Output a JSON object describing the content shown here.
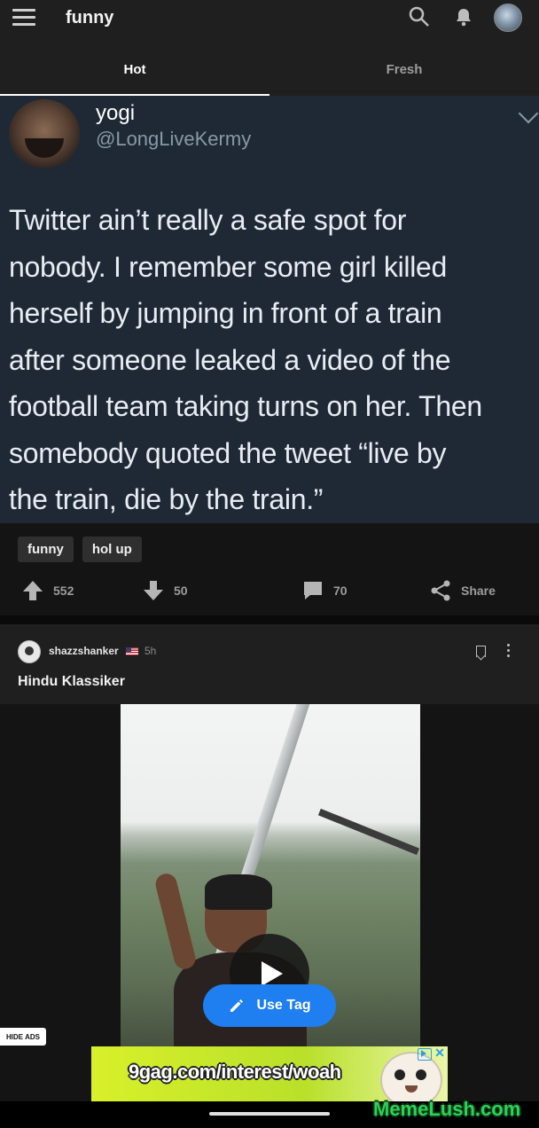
{
  "header": {
    "title": "funny"
  },
  "tabs": [
    {
      "label": "Hot",
      "active": true
    },
    {
      "label": "Fresh",
      "active": false
    }
  ],
  "post1": {
    "tweet": {
      "name": "yogi",
      "handle": "@LongLiveKermy",
      "lines": [
        "Twitter ain’t really a safe spot for",
        "nobody. I remember some girl killed",
        "herself by jumping in front of a train",
        "after someone leaked a video of the",
        "football team taking turns on her. Then",
        "somebody quoted the tweet “live by",
        "the train, die by the train.”"
      ]
    },
    "tags": [
      "funny",
      "hol up"
    ],
    "actions": {
      "upvotes": "552",
      "downvotes": "50",
      "comments": "70",
      "share_label": "Share"
    }
  },
  "post2": {
    "username": "shazzshanker",
    "time": "5h",
    "title": "Hindu Klassiker",
    "use_tag_label": "Use Tag"
  },
  "ads": {
    "hide_label": "HIDE ADS",
    "banner_text": "9gag.com/interest/woah"
  },
  "watermark": "MemeLush.com",
  "colors": {
    "accent": "#1f7ef0",
    "tweet_bg": "#1f2936",
    "bg": "#141414"
  }
}
